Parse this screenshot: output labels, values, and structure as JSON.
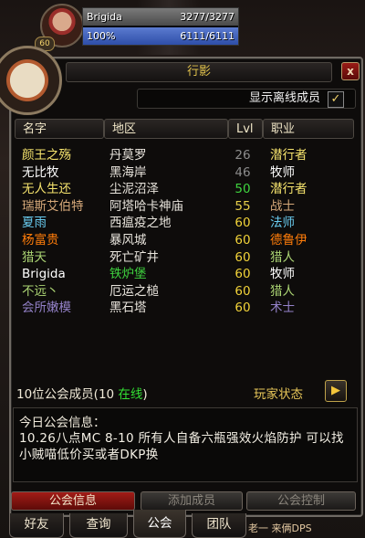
{
  "unit_frame": {
    "name": "Brigida",
    "health": "3277/3277",
    "power_percent": "100%",
    "power": "6111/6111",
    "level_badge": "60"
  },
  "panel": {
    "title": "行影",
    "close_label": "x",
    "show_offline_label": "显示离线成员",
    "show_offline_checked": true,
    "columns": {
      "name": "名字",
      "zone": "地区",
      "level": "Lvl",
      "class": "职业"
    },
    "members": [
      {
        "name": "颜王之殇",
        "zone": "丹莫罗",
        "level": "26",
        "class": "潜行者",
        "name_color": "#f5e36d",
        "class_color": "#f5e36d",
        "level_color": "#8c8c8c"
      },
      {
        "name": "无比牧",
        "zone": "黑海岸",
        "level": "46",
        "class": "牧师",
        "name_color": "#ffffff",
        "class_color": "#ffffff",
        "level_color": "#8c8c8c"
      },
      {
        "name": "无人生还",
        "zone": "尘泥沼泽",
        "level": "50",
        "class": "潜行者",
        "name_color": "#f5e36d",
        "class_color": "#f5e36d",
        "level_color": "#3fd43f"
      },
      {
        "name": "瑞斯艾伯特",
        "zone": "阿塔哈卡神庙",
        "level": "55",
        "class": "战士",
        "name_color": "#d6a97a",
        "class_color": "#d6a97a",
        "level_color": "#e8d04a"
      },
      {
        "name": "夏雨",
        "zone": "西瘟疫之地",
        "level": "60",
        "class": "法师",
        "name_color": "#69ccf0",
        "class_color": "#69ccf0",
        "level_color": "#f2d339"
      },
      {
        "name": "杨富贵",
        "zone": "暴风城",
        "level": "60",
        "class": "德鲁伊",
        "name_color": "#ff7d0a",
        "class_color": "#ff7d0a",
        "level_color": "#f2d339"
      },
      {
        "name": "猎天",
        "zone": "死亡矿井",
        "level": "60",
        "class": "猎人",
        "name_color": "#abd473",
        "class_color": "#abd473",
        "level_color": "#f2d339"
      },
      {
        "name": "Brigida",
        "zone": "铁炉堡",
        "level": "60",
        "class": "牧师",
        "name_color": "#ffffff",
        "class_color": "#ffffff",
        "level_color": "#f2d339",
        "zone_color": "#3fd43f"
      },
      {
        "name": "不远丶",
        "zone": "厄运之槌",
        "level": "60",
        "class": "猎人",
        "name_color": "#abd473",
        "class_color": "#abd473",
        "level_color": "#f2d339"
      },
      {
        "name": "会所嫩模",
        "zone": "黑石塔",
        "level": "60",
        "class": "术士",
        "name_color": "#9482c9",
        "class_color": "#9482c9",
        "level_color": "#f2d339"
      }
    ],
    "members_count_prefix": "10位公会成员(10 ",
    "members_online_word": "在线",
    "members_count_suffix": ")",
    "player_status_label": "玩家状态",
    "player_status_icon": "arrow-right-icon",
    "motd_title": "今日公会信息：",
    "motd_text": "10.26八点MC 8-10 所有人自备六瓶强效火焰防护 可以找小贼喵低价买或者DKP换",
    "buttons": {
      "guild_info": "公会信息",
      "add_member": "添加成员",
      "guild_control": "公会控制"
    }
  },
  "tabs": {
    "friends": "好友",
    "who": "查询",
    "guild": "公会",
    "raid": "团队"
  },
  "chat_snippet": "老一 来俩DPS",
  "colors": {
    "title_gold": "#e2c34c",
    "button_red": "#a31c17",
    "online_green": "#33e033"
  }
}
